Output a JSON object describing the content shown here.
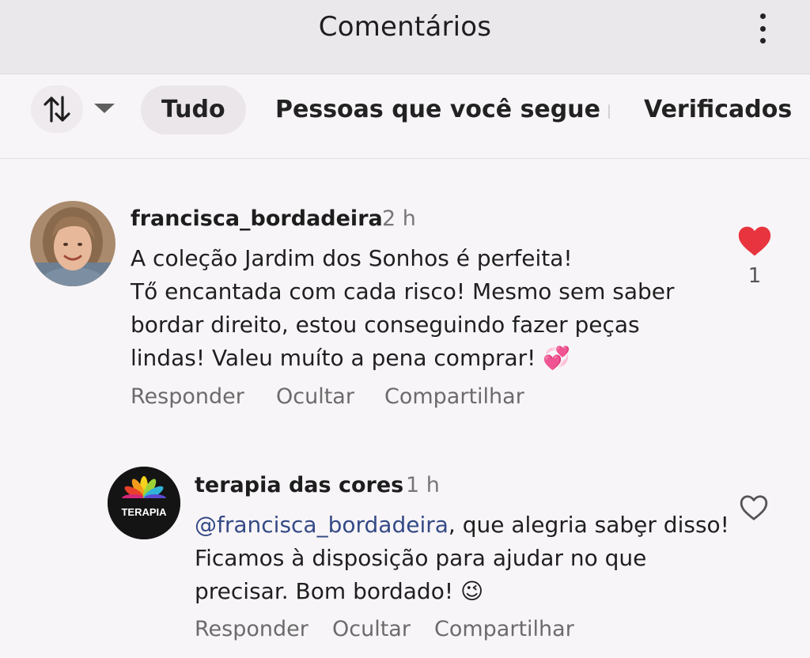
{
  "header": {
    "title": "Comentários",
    "menu_icon": "more-vertical-icon"
  },
  "filters": {
    "sort_icon": "sort-arrows-icon",
    "dropdown_icon": "caret-down-icon",
    "chips": [
      "Tudo",
      "Pessoas que você segue",
      "Verificados"
    ],
    "active": "Tudo"
  },
  "comments": [
    {
      "username": "francisca_bordadeira",
      "time": "2 h",
      "lines": [
        "A coleção Jardim dos Sonhos é perfeita!",
        "Tő encantada com cada risco! Mesmo sem saber",
        "bordar direito, estou conseguindo fazer peças",
        "lindas! Valeu muíto a pena comprar! 💞"
      ],
      "liked": true,
      "like_count": "1",
      "actions": [
        "Responder",
        "Ocultar",
        "Compartilhar"
      ]
    },
    {
      "username": "terapia das cores",
      "time": "1 h",
      "mention": "@francisca_bordadeira",
      "lines": [
        ", que alegria sabȩr disso!",
        "Ficamos à disposição para ajudar no que",
        "precisar. Bom bordado! 😉"
      ],
      "avatar_text": "TERAPIA",
      "liked": false,
      "actions": [
        "Responder",
        "Ocultar",
        "Compartilhar"
      ]
    }
  ],
  "colors": {
    "like_red": "#e8343f",
    "mention_blue": "#344a86"
  }
}
